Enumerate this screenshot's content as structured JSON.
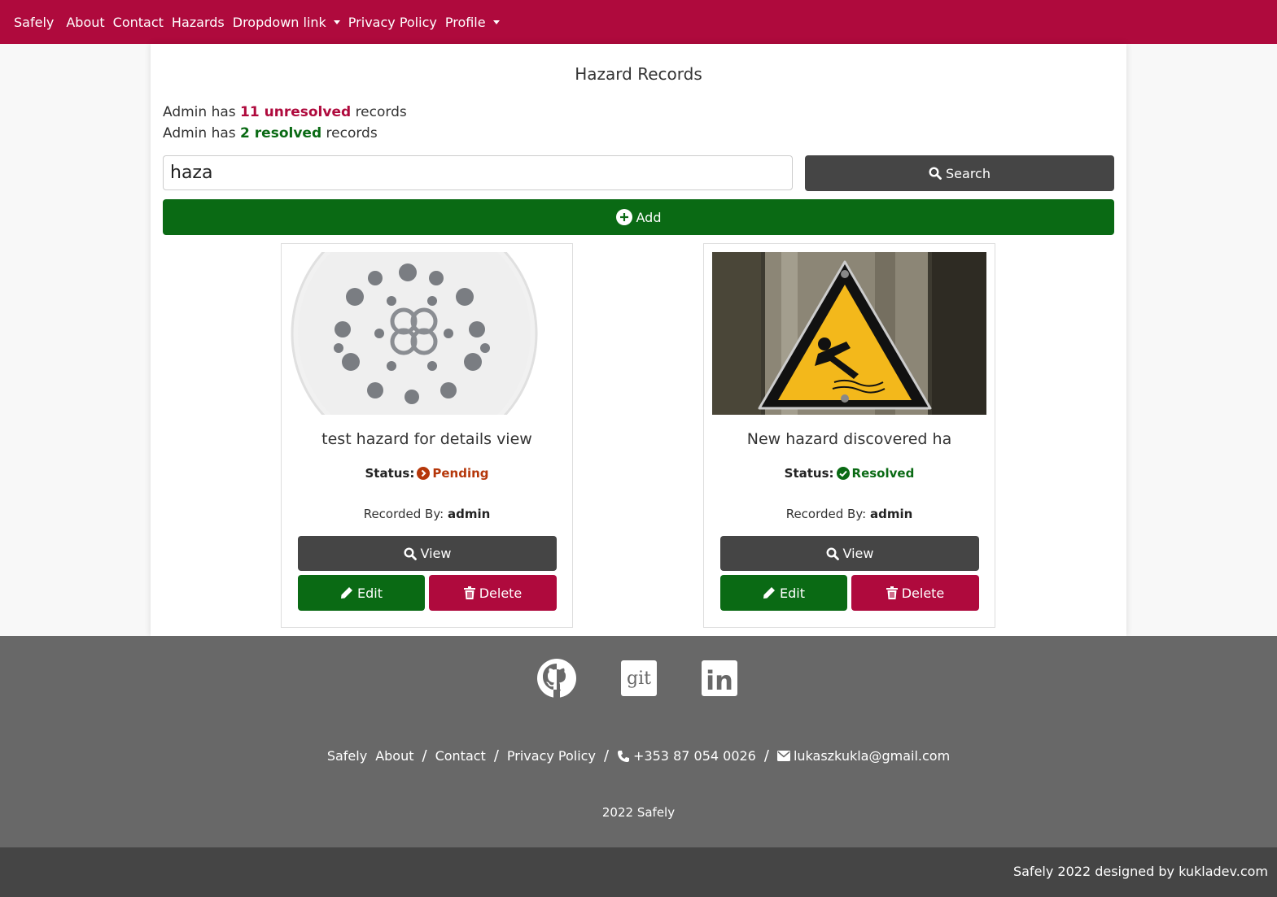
{
  "navbar": {
    "brand": "Safely",
    "items": [
      "About",
      "Contact",
      "Hazards"
    ],
    "dropdown_label": "Dropdown link",
    "privacy": "Privacy Policy",
    "profile_label": "Profile"
  },
  "main": {
    "title": "Hazard Records",
    "unresolved_prefix": "Admin has",
    "unresolved_count": "11 unresolved",
    "unresolved_suffix": "records",
    "resolved_prefix": "Admin has",
    "resolved_count": "2 resolved",
    "resolved_suffix": "records",
    "search_value": "haza",
    "search_button": "Search",
    "add_button": "Add"
  },
  "cards": [
    {
      "title": "test hazard for details view",
      "status_label": "Status:",
      "status": "Pending",
      "recorded_label": "Recorded By:",
      "recorded_by": "admin",
      "view": "View",
      "edit": "Edit",
      "delete": "Delete"
    },
    {
      "title": "New hazard discovered ha",
      "status_label": "Status:",
      "status": "Resolved",
      "recorded_label": "Recorded By:",
      "recorded_by": "admin",
      "view": "View",
      "edit": "Edit",
      "delete": "Delete"
    }
  ],
  "footer": {
    "links": [
      "Safely",
      "About",
      "Contact",
      "Privacy Policy"
    ],
    "phone": "+353 87 054 0026",
    "email": "lukaszkukla@gmail.com",
    "copyright": "2022 Safely",
    "designed_by": "Safely 2022 designed by kukladev.com",
    "git_text": "git",
    "linkedin_text": "in"
  },
  "colors": {
    "brand": "#af0a3d",
    "success": "#0a6a14",
    "dark": "#454545",
    "footer": "#686868",
    "pending": "#b5370a"
  }
}
